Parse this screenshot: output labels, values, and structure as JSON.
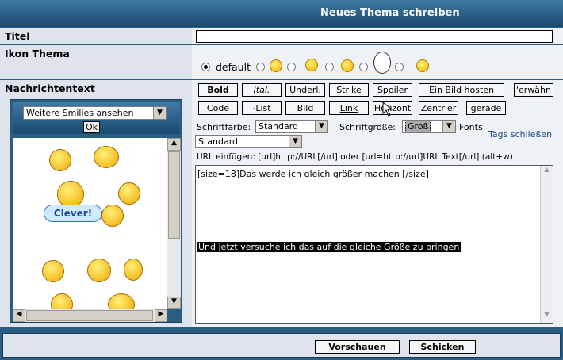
{
  "header": {
    "title": "Neues Thema schreiben"
  },
  "labels": {
    "titel": "Titel",
    "ikon": "Ikon Thema",
    "nachricht": "Nachrichtentext"
  },
  "icon_radio": {
    "default_label": "default"
  },
  "smilies_panel": {
    "select_value": "Weitere Smilies ansehen",
    "ok": "Ok",
    "clever": "Clever!"
  },
  "toolbar": {
    "row1": [
      "Bold",
      "Ital.",
      "Underl.",
      "Strike",
      "Spoiler",
      "Ein Bild hosten",
      "'erwähn"
    ],
    "row2": [
      "Code",
      "-List",
      "Bild",
      "Link",
      "Horizont",
      "Zentrier",
      "gerade"
    ]
  },
  "format": {
    "schriftfarbe_label": "Schriftfarbe:",
    "schriftfarbe_value": "Standard",
    "schriftgroesse_label": "Schriftgröße:",
    "schriftgroesse_value": "Groß",
    "fonts_label": "Fonts:",
    "tags_link": "Tags schließen",
    "font_value": "Standard"
  },
  "url_hint": "URL einfügen: [url]http://URL[/url] oder [url=http://url]URL Text[/url] (alt+w)",
  "editor": {
    "line1": "[size=18]Das werde ich gleich größer machen [/size]",
    "selected": "Und jetzt versuche ich das auf die gleiche Größe zu bringen"
  },
  "footer": {
    "preview": "Vorschauen",
    "submit": "Schicken"
  }
}
